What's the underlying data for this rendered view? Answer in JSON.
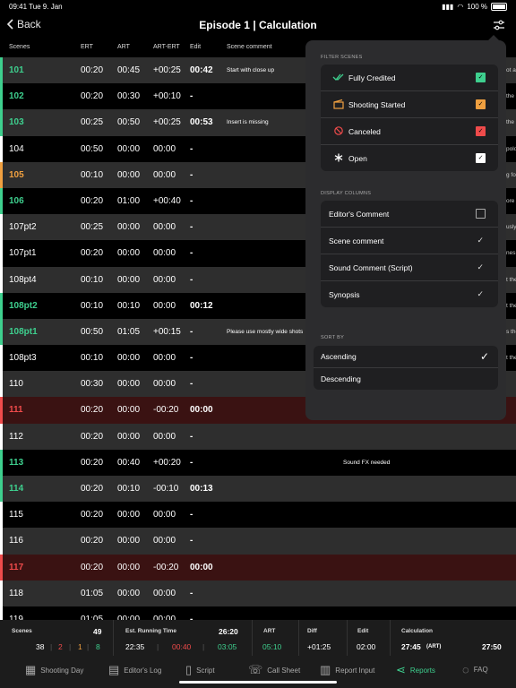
{
  "status_bar": {
    "time_date": "09:41  Tue 9. Jan",
    "battery": "100 %"
  },
  "nav": {
    "back_label": "Back",
    "title": "Episode 1 | Calculation"
  },
  "columns": {
    "scenes": "Scenes",
    "erts": "ERT",
    "art": "ART",
    "diff": "ART-ERT",
    "edit": "Edit",
    "comment": "Scene comment"
  },
  "colors": {
    "green": "#3ecf8e",
    "orange": "#f0a040",
    "red": "#ef4b4b",
    "white": "#ffffff"
  },
  "rows": [
    {
      "scene": "101",
      "ert": "00:20",
      "art": "00:45",
      "diff": "+00:25",
      "edit": "00:42",
      "comment": "Start with close up",
      "status": "green",
      "edge": "ot a"
    },
    {
      "scene": "102",
      "ert": "00:20",
      "art": "00:30",
      "diff": "+00:10",
      "edit": "-",
      "comment": "",
      "status": "green",
      "edge": "the"
    },
    {
      "scene": "103",
      "ert": "00:25",
      "art": "00:50",
      "diff": "+00:25",
      "edit": "00:53",
      "comment": "Insert is missing",
      "status": "green",
      "edge": "the"
    },
    {
      "scene": "104",
      "ert": "00:50",
      "art": "00:00",
      "diff": "00:00",
      "edit": "-",
      "comment": "",
      "status": "white",
      "edge": "polo"
    },
    {
      "scene": "105",
      "ert": "00:10",
      "art": "00:00",
      "diff": "00:00",
      "edit": "-",
      "comment": "",
      "status": "orange",
      "edge": "g fo"
    },
    {
      "scene": "106",
      "ert": "00:20",
      "art": "01:00",
      "diff": "+00:40",
      "edit": "-",
      "comment": "",
      "status": "green",
      "edge": "ore"
    },
    {
      "scene": "107pt2",
      "ert": "00:25",
      "art": "00:00",
      "diff": "00:00",
      "edit": "-",
      "comment": "",
      "status": "white",
      "edge": "usly"
    },
    {
      "scene": "107pt1",
      "ert": "00:20",
      "art": "00:00",
      "diff": "00:00",
      "edit": "-",
      "comment": "",
      "status": "white",
      "edge": "nes,"
    },
    {
      "scene": "108pt4",
      "ert": "00:10",
      "art": "00:00",
      "diff": "00:00",
      "edit": "-",
      "comment": "",
      "status": "white",
      "edge": "t the"
    },
    {
      "scene": "108pt2",
      "ert": "00:10",
      "art": "00:10",
      "diff": "00:00",
      "edit": "00:12",
      "comment": "",
      "status": "green",
      "edge": "t the"
    },
    {
      "scene": "108pt1",
      "ert": "00:50",
      "art": "01:05",
      "diff": "+00:15",
      "edit": "-",
      "comment": "Please use mostly wide shots",
      "status": "green",
      "edge": "s the"
    },
    {
      "scene": "108pt3",
      "ert": "00:10",
      "art": "00:00",
      "diff": "00:00",
      "edit": "-",
      "comment": "",
      "status": "white",
      "edge": "t the"
    },
    {
      "scene": "110",
      "ert": "00:30",
      "art": "00:00",
      "diff": "00:00",
      "edit": "-",
      "comment": "",
      "status": "white",
      "edge": ""
    },
    {
      "scene": "111",
      "ert": "00:20",
      "art": "00:00",
      "diff": "-00:20",
      "edit": "00:00",
      "comment": "",
      "status": "red",
      "edge": ""
    },
    {
      "scene": "112",
      "ert": "00:20",
      "art": "00:00",
      "diff": "00:00",
      "edit": "-",
      "comment": "",
      "status": "white",
      "edge": ""
    },
    {
      "scene": "113",
      "ert": "00:20",
      "art": "00:40",
      "diff": "+00:20",
      "edit": "-",
      "comment": "Sound FX needed",
      "status": "green",
      "edge": ""
    },
    {
      "scene": "114",
      "ert": "00:20",
      "art": "00:10",
      "diff": "-00:10",
      "edit": "00:13",
      "comment": "",
      "status": "green",
      "edge": ""
    },
    {
      "scene": "115",
      "ert": "00:20",
      "art": "00:00",
      "diff": "00:00",
      "edit": "-",
      "comment": "",
      "status": "white",
      "edge": ""
    },
    {
      "scene": "116",
      "ert": "00:20",
      "art": "00:00",
      "diff": "00:00",
      "edit": "-",
      "comment": "",
      "status": "white",
      "edge": ""
    },
    {
      "scene": "117",
      "ert": "00:20",
      "art": "00:00",
      "diff": "-00:20",
      "edit": "00:00",
      "comment": "",
      "status": "red",
      "edge": ""
    },
    {
      "scene": "118",
      "ert": "01:05",
      "art": "00:00",
      "diff": "00:00",
      "edit": "-",
      "comment": "",
      "status": "white",
      "edge": ""
    },
    {
      "scene": "119",
      "ert": "01:05",
      "art": "00:00",
      "diff": "00:00",
      "edit": "-",
      "comment": "",
      "status": "white",
      "edge": ""
    }
  ],
  "filter": {
    "filter_title": "FILTER SCENES",
    "filters": [
      {
        "label": "Fully Credited",
        "icon": "double-check-icon",
        "checked": true,
        "color": "#3ecf8e"
      },
      {
        "label": "Shooting Started",
        "icon": "clapperboard-icon",
        "checked": true,
        "color": "#f0a040"
      },
      {
        "label": "Canceled",
        "icon": "prohibited-icon",
        "checked": true,
        "color": "#ef4b4b"
      },
      {
        "label": "Open",
        "icon": "asterisk-icon",
        "checked": true,
        "color": "#ffffff"
      }
    ],
    "display_title": "DISPLAY COLUMNS",
    "display": [
      {
        "label": "Editor's Comment",
        "checked": false,
        "style": "box"
      },
      {
        "label": "Scene comment",
        "checked": true,
        "style": "check"
      },
      {
        "label": "Sound Comment (Script)",
        "checked": true,
        "style": "check"
      },
      {
        "label": "Synopsis",
        "checked": true,
        "style": "check"
      }
    ],
    "sort_title": "SORT BY",
    "sort": [
      {
        "label": "Ascending",
        "selected": true
      },
      {
        "label": "Descending",
        "selected": false
      }
    ]
  },
  "summary": {
    "scenes_label": "Scenes",
    "scenes_total": "49",
    "count_white": "38",
    "count_red": "2",
    "count_orange": "1",
    "count_green": "8",
    "ert_label": "Est. Running Time",
    "ert_total": "26:20",
    "ert_white": "22:35",
    "ert_red": "00:40",
    "ert_green": "03:05",
    "art_label": "ART",
    "art_value": "05:10",
    "diff_label": "Diff",
    "diff_value": "+01:25",
    "edit_label": "Edit",
    "edit_value": "02:00",
    "calc_label": "Calculation",
    "calc_value": "27:45",
    "calc_tag": "(ART)",
    "calc_total": "27:50"
  },
  "tabs": [
    {
      "label": "Shooting Day",
      "icon": "calendar-icon"
    },
    {
      "label": "Editor's Log",
      "icon": "log-icon"
    },
    {
      "label": "Script",
      "icon": "script-icon"
    },
    {
      "label": "Call Sheet",
      "icon": "phone-icon"
    },
    {
      "label": "Report Input",
      "icon": "report-icon"
    },
    {
      "label": "Reports",
      "icon": "share-icon",
      "active": true
    },
    {
      "label": "FAQ",
      "icon": "chat-icon"
    }
  ]
}
